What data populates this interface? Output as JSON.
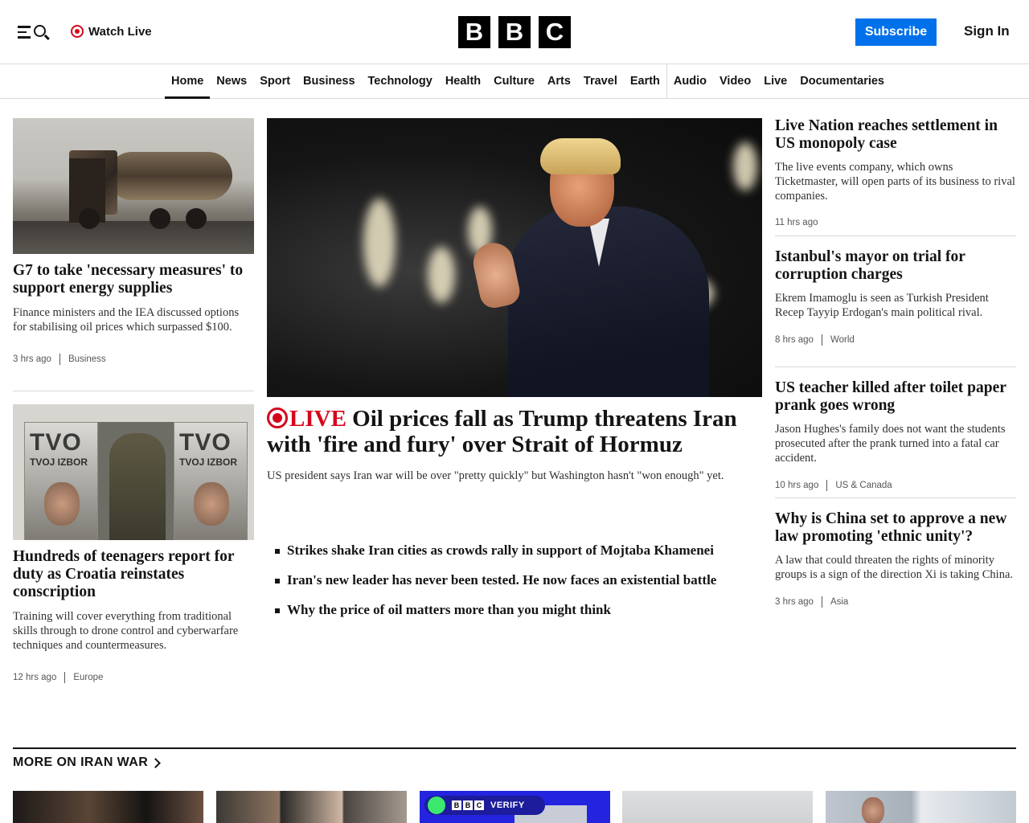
{
  "header": {
    "watch_live": "Watch Live",
    "logo_letters": [
      "B",
      "B",
      "C"
    ],
    "subscribe": "Subscribe",
    "sign_in": "Sign In",
    "accent_color": "#0071eb",
    "live_color": "#d4061c"
  },
  "nav": {
    "items": [
      "Home",
      "News",
      "Sport",
      "Business",
      "Technology",
      "Health",
      "Culture",
      "Arts",
      "Travel",
      "Earth",
      "Audio",
      "Video",
      "Live",
      "Documentaries"
    ],
    "active": "Home"
  },
  "left": {
    "story1": {
      "headline": "G7 to take 'necessary measures' to support energy supplies",
      "summary": "Finance ministers and the IEA discussed options for stabilising oil prices which surpassed $100.",
      "time": "3 hrs ago",
      "tag": "Business"
    },
    "story2": {
      "headline": "Hundreds of teenagers report for duty as Croatia reinstates conscription",
      "summary": "Training will cover everything from traditional skills through to drone control and cyberwarfare techniques and countermeasures.",
      "time": "12 hrs ago",
      "tag": "Europe",
      "banner_title": "TVO",
      "banner_subtitle": "TVOJ IZBOR"
    }
  },
  "lead": {
    "live_label": "LIVE",
    "headline": "Oil prices fall as Trump threatens Iran with 'fire and fury' over Strait of Hormuz",
    "summary": "US president says Iran war will be over \"pretty quickly\" but Washington hasn't \"won enough\" yet.",
    "related": [
      "Strikes shake Iran cities as crowds rally in support of Mojtaba Khamenei",
      "Iran's new leader has never been tested. He now faces an existential battle",
      "Why the price of oil matters more than you might think"
    ]
  },
  "right": {
    "stories": [
      {
        "headline": "Live Nation reaches settlement in US monopoly case",
        "summary": "The live events company, which owns Ticketmaster, will open parts of its business to rival companies.",
        "time": "11 hrs ago",
        "tag": ""
      },
      {
        "headline": "Istanbul's mayor on trial for corruption charges",
        "summary": "Ekrem Imamoglu is seen as Turkish President Recep Tayyip Erdogan's main political rival.",
        "time": "8 hrs ago",
        "tag": "World"
      },
      {
        "headline": "US teacher killed after toilet paper prank goes wrong",
        "summary": "Jason Hughes's family does not want the students prosecuted after the prank turned into a fatal car accident.",
        "time": "10 hrs ago",
        "tag": "US & Canada"
      },
      {
        "headline": "Why is China set to approve a new law promoting 'ethnic unity'?",
        "summary": "A law that could threaten the rights of minority groups is a sign of the direction Xi is taking China.",
        "time": "3 hrs ago",
        "tag": "Asia"
      }
    ]
  },
  "section": {
    "title": "MORE ON IRAN WAR",
    "verify_label": "VERIFY"
  }
}
